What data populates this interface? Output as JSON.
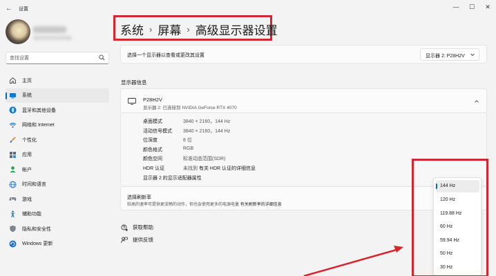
{
  "window": {
    "app_title": "设置",
    "back_glyph": "←",
    "minimize_glyph": "—",
    "maximize_glyph": "☐",
    "close_glyph": "✕"
  },
  "search": {
    "placeholder": "查找设置"
  },
  "sidebar": {
    "items": [
      {
        "label": "主页",
        "icon": "home-icon"
      },
      {
        "label": "系统",
        "icon": "system-icon",
        "active": true
      },
      {
        "label": "蓝牙和其他设备",
        "icon": "bluetooth-icon"
      },
      {
        "label": "网络和 Internet",
        "icon": "wifi-icon"
      },
      {
        "label": "个性化",
        "icon": "brush-icon"
      },
      {
        "label": "应用",
        "icon": "apps-icon"
      },
      {
        "label": "帐户",
        "icon": "account-icon"
      },
      {
        "label": "时间和语言",
        "icon": "globe-clock-icon"
      },
      {
        "label": "游戏",
        "icon": "gamepad-icon"
      },
      {
        "label": "辅助功能",
        "icon": "accessibility-icon"
      },
      {
        "label": "隐私和安全性",
        "icon": "shield-icon"
      },
      {
        "label": "Windows 更新",
        "icon": "update-icon"
      }
    ]
  },
  "breadcrumb": {
    "items": [
      "系统",
      "屏幕",
      "高级显示器设置"
    ],
    "separator": "›"
  },
  "select_display": {
    "label": "选择一个显示器以查看或更改其设置",
    "dropdown_value": "显示器 2: P28H2V"
  },
  "display_info": {
    "heading": "显示器信息",
    "monitor_name": "P28H2V",
    "monitor_sub": "显示器 2: 已连接到 NVIDIA GeForce RTX 4070",
    "rows": [
      {
        "key": "桌面模式",
        "value": "3840 × 2160，144 Hz"
      },
      {
        "key": "活动信号模式",
        "value": "3840 × 2160，144 Hz"
      },
      {
        "key": "位深度",
        "value": "8 位"
      },
      {
        "key": "颜色格式",
        "value": "RGB"
      },
      {
        "key": "颜色空间",
        "value": "标准动态范围(SDR)"
      },
      {
        "key": "HDR 认证",
        "value": "未找到",
        "link": "有关 HDR 认证的详细信息"
      }
    ],
    "adapter_link": "显示器 2 的显示适配器属性"
  },
  "refresh": {
    "title": "选择刷新率",
    "description": "较高的速率可提供更流畅的动作，但也会使用更多的电源电量",
    "link": "有关刷新率的详细信息"
  },
  "refresh_options": [
    "144 Hz",
    "120 Hz",
    "119.88 Hz",
    "60 Hz",
    "59.94 Hz",
    "50 Hz",
    "30 Hz"
  ],
  "refresh_selected": "144 Hz",
  "links": {
    "help": "获取帮助",
    "feedback": "提供反馈"
  },
  "colors": {
    "accent": "#0067c0",
    "annotation_red": "#d6252c",
    "background": "#f3f3f3"
  }
}
